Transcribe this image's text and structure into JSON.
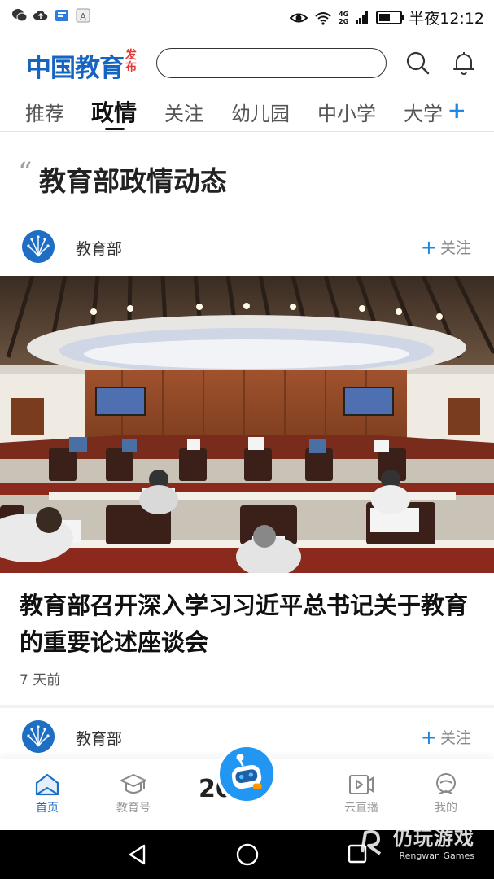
{
  "status_bar": {
    "time": "半夜12:12",
    "network": [
      "4G",
      "2G"
    ],
    "battery_level": 0.55,
    "left_icons": [
      "wechat-icon",
      "cloud-upload-icon",
      "message-icon",
      "a-icon"
    ]
  },
  "header": {
    "logo_main": "中国教育",
    "logo_sub": "发布",
    "search_placeholder": "",
    "colors": {
      "brand": "#1565c0",
      "accent_red": "#e53935"
    }
  },
  "tabs": [
    {
      "label": "推荐",
      "active": false
    },
    {
      "label": "政情",
      "active": true
    },
    {
      "label": "关注",
      "active": false
    },
    {
      "label": "幼儿园",
      "active": false
    },
    {
      "label": "中小学",
      "active": false
    },
    {
      "label": "大学",
      "active": false
    }
  ],
  "section": {
    "title": "教育部政情动态"
  },
  "cards": [
    {
      "source": "教育部",
      "follow_label": "关注",
      "headline": "教育部召开深入学习习近平总书记关于教育的重要论述座谈会",
      "time": "7 天前"
    },
    {
      "source": "教育部",
      "follow_label": "关注",
      "peek_text": "20  国"
    }
  ],
  "bottom_nav": [
    {
      "label": "首页",
      "icon": "home-icon",
      "active": true
    },
    {
      "label": "教育号",
      "icon": "graduation-cap-icon",
      "active": false
    },
    {
      "label": "",
      "icon": "robot-assistant-icon",
      "active": false
    },
    {
      "label": "云直播",
      "icon": "video-play-icon",
      "active": false
    },
    {
      "label": "我的",
      "icon": "user-profile-icon",
      "active": false
    }
  ],
  "watermark": {
    "main": "仍玩游戏",
    "sub": "Rengwan Games"
  }
}
